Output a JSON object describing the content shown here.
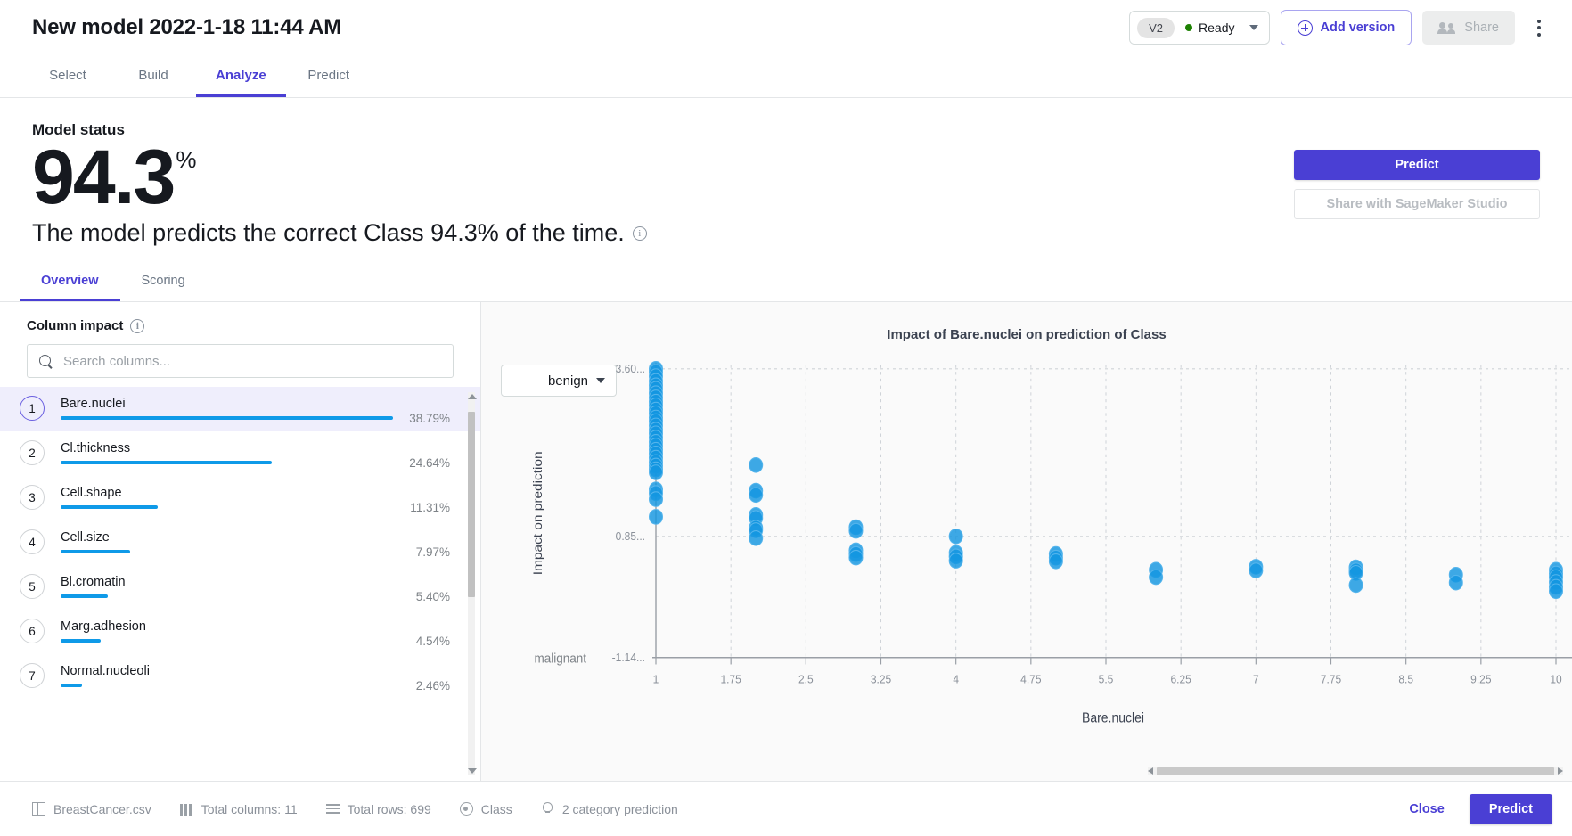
{
  "header": {
    "title": "New model 2022-1-18 11:44 AM",
    "version_badge": "V2",
    "status_text": "Ready",
    "status_color": "#1d8102",
    "add_version_label": "Add version",
    "share_label": "Share",
    "accent_color": "#4a3fd4"
  },
  "nav_tabs": [
    {
      "label": "Select",
      "active": false
    },
    {
      "label": "Build",
      "active": false
    },
    {
      "label": "Analyze",
      "active": true
    },
    {
      "label": "Predict",
      "active": false
    }
  ],
  "status": {
    "label": "Model status",
    "value": "94.3",
    "unit": "%",
    "sentence": "The model predicts the correct Class 94.3% of the time.",
    "predict_label": "Predict",
    "sagemaker_label": "Share with SageMaker Studio"
  },
  "sub_tabs": [
    {
      "label": "Overview",
      "active": true
    },
    {
      "label": "Scoring",
      "active": false
    }
  ],
  "column_impact": {
    "title": "Column impact",
    "search_placeholder": "Search columns...",
    "search_value": "",
    "items": [
      {
        "rank": "1",
        "name": "Bare.nuclei",
        "pct": "38.79%",
        "value": 38.79,
        "selected": true
      },
      {
        "rank": "2",
        "name": "Cl.thickness",
        "pct": "24.64%",
        "value": 24.64,
        "selected": false
      },
      {
        "rank": "3",
        "name": "Cell.shape",
        "pct": "11.31%",
        "value": 11.31,
        "selected": false
      },
      {
        "rank": "4",
        "name": "Cell.size",
        "pct": "7.97%",
        "value": 7.97,
        "selected": false
      },
      {
        "rank": "5",
        "name": "Bl.cromatin",
        "pct": "5.40%",
        "value": 5.4,
        "selected": false
      },
      {
        "rank": "6",
        "name": "Marg.adhesion",
        "pct": "4.54%",
        "value": 4.54,
        "selected": false
      },
      {
        "rank": "7",
        "name": "Normal.nucleoli",
        "pct": "2.46%",
        "value": 2.46,
        "selected": false
      }
    ]
  },
  "chart_data": {
    "type": "scatter",
    "title": "Impact of Bare.nuclei on prediction of Class",
    "xlabel": "Bare.nuclei",
    "ylabel": "Impact on prediction",
    "class_selector_value": "benign",
    "class_axis_top": "benign",
    "class_axis_bottom": "malignant",
    "point_color": "#1496e0",
    "grid": true,
    "xticks": [
      "1",
      "1.75",
      "2.5",
      "3.25",
      "4",
      "4.75",
      "5.5",
      "6.25",
      "7",
      "7.75",
      "8.5",
      "9.25",
      "10"
    ],
    "xtick_values": [
      1,
      1.75,
      2.5,
      3.25,
      4,
      4.75,
      5.5,
      6.25,
      7,
      7.75,
      8.5,
      9.25,
      10
    ],
    "yticks": [
      "3.60...",
      "0.85...",
      "-1.14..."
    ],
    "ytick_values": [
      3.6,
      0.85,
      -1.14
    ],
    "xlim": [
      1,
      10
    ],
    "ylim": [
      -1.14,
      3.6
    ],
    "points": [
      {
        "x": 1,
        "y": 3.6
      },
      {
        "x": 1,
        "y": 3.55
      },
      {
        "x": 1,
        "y": 3.48
      },
      {
        "x": 1,
        "y": 3.4
      },
      {
        "x": 1,
        "y": 3.33
      },
      {
        "x": 1,
        "y": 3.27
      },
      {
        "x": 1,
        "y": 3.2
      },
      {
        "x": 1,
        "y": 3.13
      },
      {
        "x": 1,
        "y": 3.06
      },
      {
        "x": 1,
        "y": 3.0
      },
      {
        "x": 1,
        "y": 2.93
      },
      {
        "x": 1,
        "y": 2.87
      },
      {
        "x": 1,
        "y": 2.8
      },
      {
        "x": 1,
        "y": 2.74
      },
      {
        "x": 1,
        "y": 2.67
      },
      {
        "x": 1,
        "y": 2.6
      },
      {
        "x": 1,
        "y": 2.54
      },
      {
        "x": 1,
        "y": 2.47
      },
      {
        "x": 1,
        "y": 2.4
      },
      {
        "x": 1,
        "y": 2.34
      },
      {
        "x": 1,
        "y": 2.27
      },
      {
        "x": 1,
        "y": 2.21
      },
      {
        "x": 1,
        "y": 2.14
      },
      {
        "x": 1,
        "y": 2.07
      },
      {
        "x": 1,
        "y": 2.01
      },
      {
        "x": 1,
        "y": 1.95
      },
      {
        "x": 1,
        "y": 1.9
      },
      {
        "x": 1,
        "y": 1.62
      },
      {
        "x": 1,
        "y": 1.56
      },
      {
        "x": 1,
        "y": 1.46
      },
      {
        "x": 1,
        "y": 1.17
      },
      {
        "x": 2.0,
        "y": 2.02
      },
      {
        "x": 2.0,
        "y": 1.6
      },
      {
        "x": 2.0,
        "y": 1.53
      },
      {
        "x": 2.0,
        "y": 1.2
      },
      {
        "x": 2.0,
        "y": 1.15
      },
      {
        "x": 2.0,
        "y": 0.99
      },
      {
        "x": 2.0,
        "y": 0.95
      },
      {
        "x": 2.0,
        "y": 0.82
      },
      {
        "x": 3.0,
        "y": 1.0
      },
      {
        "x": 3.0,
        "y": 0.94
      },
      {
        "x": 3.0,
        "y": 0.62
      },
      {
        "x": 3.0,
        "y": 0.56
      },
      {
        "x": 3.0,
        "y": 0.5
      },
      {
        "x": 4.0,
        "y": 0.85
      },
      {
        "x": 4.0,
        "y": 0.58
      },
      {
        "x": 4.0,
        "y": 0.52
      },
      {
        "x": 4.0,
        "y": 0.45
      },
      {
        "x": 5.0,
        "y": 0.56
      },
      {
        "x": 5.0,
        "y": 0.5
      },
      {
        "x": 5.0,
        "y": 0.44
      },
      {
        "x": 6.0,
        "y": 0.3
      },
      {
        "x": 6.0,
        "y": 0.18
      },
      {
        "x": 7.0,
        "y": 0.35
      },
      {
        "x": 7.0,
        "y": 0.29
      },
      {
        "x": 8.0,
        "y": 0.34
      },
      {
        "x": 8.0,
        "y": 0.29
      },
      {
        "x": 8.0,
        "y": 0.25
      },
      {
        "x": 8.0,
        "y": 0.05
      },
      {
        "x": 9.0,
        "y": 0.22
      },
      {
        "x": 9.0,
        "y": 0.09
      },
      {
        "x": 10,
        "y": 0.3
      },
      {
        "x": 10,
        "y": 0.24
      },
      {
        "x": 10,
        "y": 0.18
      },
      {
        "x": 10,
        "y": 0.1
      },
      {
        "x": 10,
        "y": 0.02
      },
      {
        "x": 10,
        "y": -0.05
      }
    ]
  },
  "footer": {
    "dataset": "BreastCancer.csv",
    "total_columns": "Total columns: 11",
    "total_rows": "Total rows: 699",
    "target": "Class",
    "prediction_type": "2 category prediction",
    "close_label": "Close",
    "predict_label": "Predict"
  }
}
